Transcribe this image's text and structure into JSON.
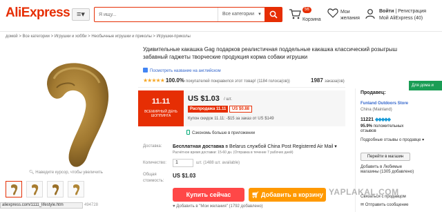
{
  "header": {
    "logo": "AliExpress",
    "search_placeholder": "Я ищу...",
    "search_category": "Все категории",
    "cart_badge": "56",
    "cart_label": "Корзина",
    "wishlist_line1": "Мои",
    "wishlist_line2": "желания",
    "login_line1": "Войти",
    "register": "Регистрация",
    "account": "Мой AliExpress (40)"
  },
  "breadcrumb": "домой > Все категории > Игрушки и хобби > Необычные игрушки и приколы > Игрушки-приколы",
  "gallery": {
    "zoom_hint": "Наведите курсор, чтобы увеличить",
    "thumbs": [
      "thumb-1",
      "thumb-2",
      "thumb-3",
      "thumb-4"
    ]
  },
  "url_bar": {
    "url": "aliexpress.com/1111_lifestyle.htm",
    "code": "494728"
  },
  "product": {
    "title": "Удивительные какашка Gag подарков реалистичная поддельные какашка классический розыгрыш забавный гаджеты творческие продукция корма собаки игрушки",
    "translate": "Посмотреть название на английском",
    "rating_pct": "100.0%",
    "rating_text": "покупателей понравился этот товар! (1184 голоса(ов))",
    "orders_count": "1987",
    "orders_label": "заказа(ов)"
  },
  "promo": {
    "banner_title": "11.11",
    "banner_sub": "ВСЕМИРНЫЙ ДЕНЬ ШОППИНГА"
  },
  "price": {
    "value": "US $1.03",
    "unit": "/ шт.",
    "sale_badge": "Распродажа 11.11",
    "discount": "US $0.88",
    "coupon": "Купон скидок 11.11: -$15 за заказ от US $149",
    "app_save": "Сэкономь больше в приложении"
  },
  "shipping": {
    "label": "Доставка:",
    "main_bold": "Бесплатная доставка",
    "main_rest": "в Belarus службой China Post Registered Air Mail",
    "sub": "Расчётное время доставки: 15-60 дн. (Отправка в течение 7 рабочих дней)"
  },
  "quantity": {
    "label": "Количество:",
    "value": "1",
    "info": "шт. (1488 шт. available)"
  },
  "total": {
    "label": "Общая стоимость:",
    "value": "US $1.03"
  },
  "buttons": {
    "buy": "Купить сейчас",
    "cart": "Добавить в корзину"
  },
  "wish": "Добавить в \"Мои желания\" (1792 добавлено)",
  "seller": {
    "title": "Продавец:",
    "name": "Funland Outdoors Store",
    "location": "China (Mainland)",
    "score": "11221",
    "positive_pct": "95.9%",
    "positive_text": "положительных отзывов",
    "more": "Подробные отзывы о продавце",
    "shop_button": "Перейти в магазин",
    "fav": "Добавить в Любимые магазины (1305 добавлено)",
    "contact": "Связаться с продавцом",
    "message": "Отправить сообщение"
  },
  "side_tab": "Для дома и",
  "watermark": "YAPLAKAL.COM",
  "colors": {
    "brand": "#e62e04",
    "buy": "#ff4747",
    "cart": "#ff9900",
    "link": "#3366cc",
    "side_tab": "#1a9d55"
  }
}
